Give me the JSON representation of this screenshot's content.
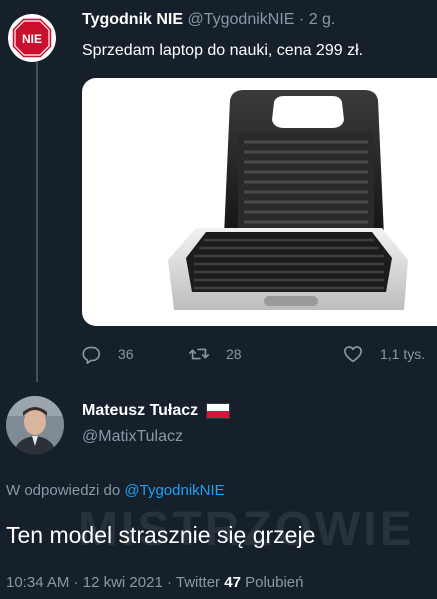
{
  "tweet": {
    "author_name": "Tygodnik NIE",
    "author_handle": "@TygodnikNIE",
    "separator": "·",
    "age": "2 g.",
    "avatar_text": "NIE",
    "text": "Sprzedam laptop do nauki, cena 299 zł.",
    "replies": "36",
    "retweets": "28",
    "likes": "1,1 tys."
  },
  "reply": {
    "author_name": "Mateusz Tułacz",
    "author_handle": "@MatixTulacz",
    "reply_to_label": "W odpowiedzi do",
    "reply_to_handle": "@TygodnikNIE",
    "text": "Ten model strasznie się grzeje",
    "time": "10:34 AM",
    "date": "12 kwi 2021",
    "source": "Twitter",
    "separator": "·",
    "like_count": "47",
    "like_label": "Polubień"
  },
  "watermark": "MISTRZOWIE",
  "colors": {
    "background": "#15202b",
    "secondary_text": "#8899a6",
    "link": "#1da1f2",
    "thread_line": "#3d5466",
    "stop_red": "#c8102e"
  },
  "icons": [
    "reply-icon",
    "retweet-icon",
    "heart-icon",
    "stop-sign-icon",
    "poland-flag-icon"
  ]
}
